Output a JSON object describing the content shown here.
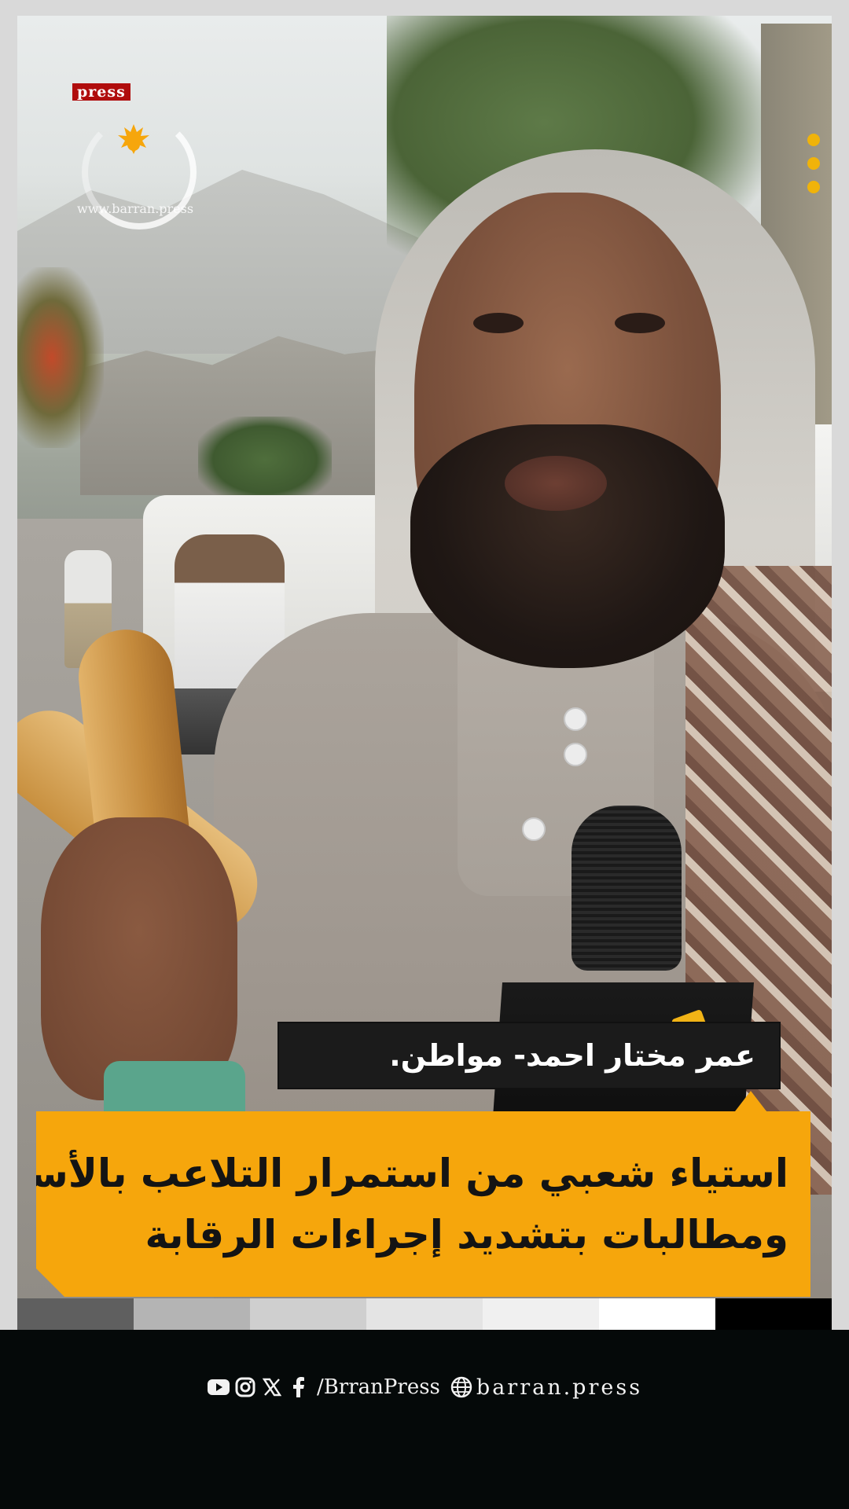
{
  "logo": {
    "badge": "press",
    "url": "www.barran.press"
  },
  "lower_third": {
    "name": "عمر مختار احمد- مواطن."
  },
  "headline": {
    "line1": "استياء شعبي من استمرار التلاعب بالأسعار",
    "line2": "ومطالبات بتشديد إجراءات الرقابة"
  },
  "footer": {
    "social_icons": [
      "youtube-icon",
      "instagram-icon",
      "x-icon",
      "facebook-icon"
    ],
    "handle": "/BrranPress",
    "website_icon": "globe-icon",
    "website": "barran.press"
  },
  "colors": {
    "accent": "#f6a60c",
    "name_box": "#1b1b1b",
    "badge": "#b00d0d",
    "footer_bg": "#050909"
  },
  "color_bars": [
    "#5f5f5f",
    "#b4b4b4",
    "#cfcfcf",
    "#e4e4e4",
    "#f0f0f0",
    "#ffffff",
    "#000000"
  ]
}
